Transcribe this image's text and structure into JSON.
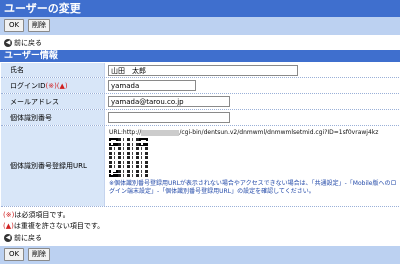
{
  "header": {
    "title": "ユーザーの変更"
  },
  "toolbar": {
    "ok_label": "OK",
    "delete_label": "削除"
  },
  "nav": {
    "back_label": "前に戻る"
  },
  "section": {
    "title": "ユーザー情報"
  },
  "form": {
    "name": {
      "label": "氏名",
      "value": "山田　太郎"
    },
    "login_id": {
      "label": "ログインID",
      "mark": "(※)(▲)",
      "value": "yamada"
    },
    "email": {
      "label": "メールアドレス",
      "value": "yamada@tarou.co.jp"
    },
    "device_id": {
      "label": "個体識別番号",
      "value": ""
    },
    "device_url": {
      "label": "個体識別番号登録用URL",
      "url_prefix": "URL:http://",
      "url_suffix": "/cgi-bin/dentsun.v2/dnmwml/dnmwmlsetmid.cgi?ID=1sf0vrawj4kz",
      "note": "※個体識別番号登録用URLが表示されない場合やアクセスできない場合は、「共通設定」-「Mobile版へのログイン端末設定」-「個体識別番号登録用URL」の設定を確認してください。"
    }
  },
  "footnotes": {
    "required_mark": "(※)",
    "required_text": "は必須項目です。",
    "unique_mark": "(▲)",
    "unique_text": "は重複を許さない項目です。"
  }
}
